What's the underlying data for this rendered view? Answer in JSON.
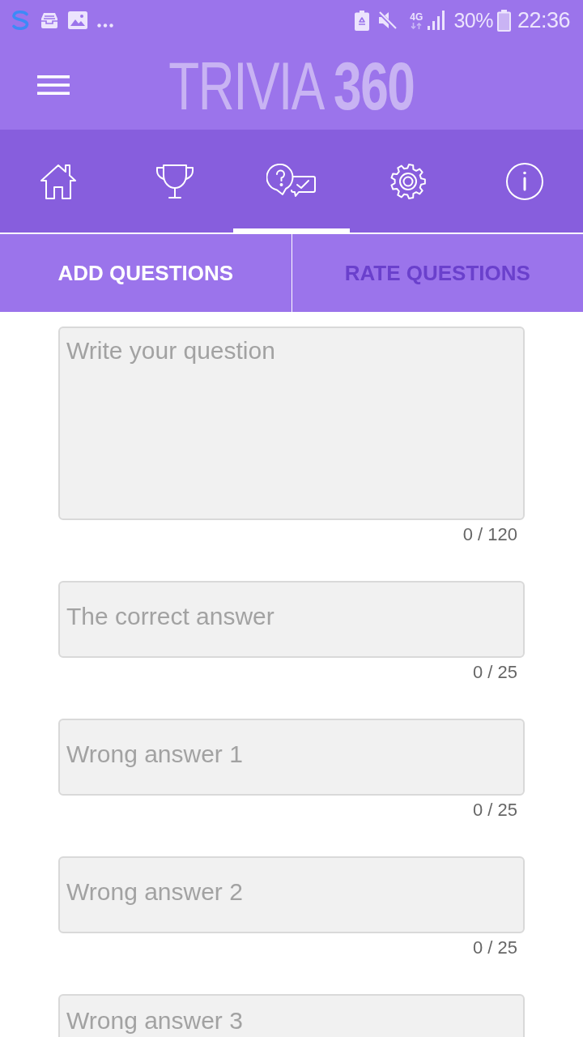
{
  "status_bar": {
    "network": "4G",
    "battery": "30%",
    "time": "22:36"
  },
  "app_bar": {
    "title": "TRIVIA **360**"
  },
  "nav": [
    {
      "kind": "home",
      "selected": false
    },
    {
      "kind": "trophy",
      "selected": false
    },
    {
      "kind": "questions",
      "selected": true
    },
    {
      "kind": "settings",
      "selected": false
    },
    {
      "kind": "info",
      "selected": false
    }
  ],
  "tabs": [
    {
      "label": "ADD QUESTIONS",
      "selected": true
    },
    {
      "label": "RATE QUESTIONS",
      "selected": false
    }
  ],
  "form": {
    "fields": [
      {
        "kind": "multiline",
        "placeholder": "Write your question",
        "counter": "0 / 120"
      },
      {
        "kind": "single",
        "placeholder": "The correct answer",
        "counter": "0 / 25"
      },
      {
        "kind": "single",
        "placeholder": "Wrong answer 1",
        "counter": "0 / 25"
      },
      {
        "kind": "single",
        "placeholder": "Wrong answer 2",
        "counter": "0 / 25"
      },
      {
        "kind": "single",
        "placeholder": "Wrong answer 3"
      }
    ]
  }
}
